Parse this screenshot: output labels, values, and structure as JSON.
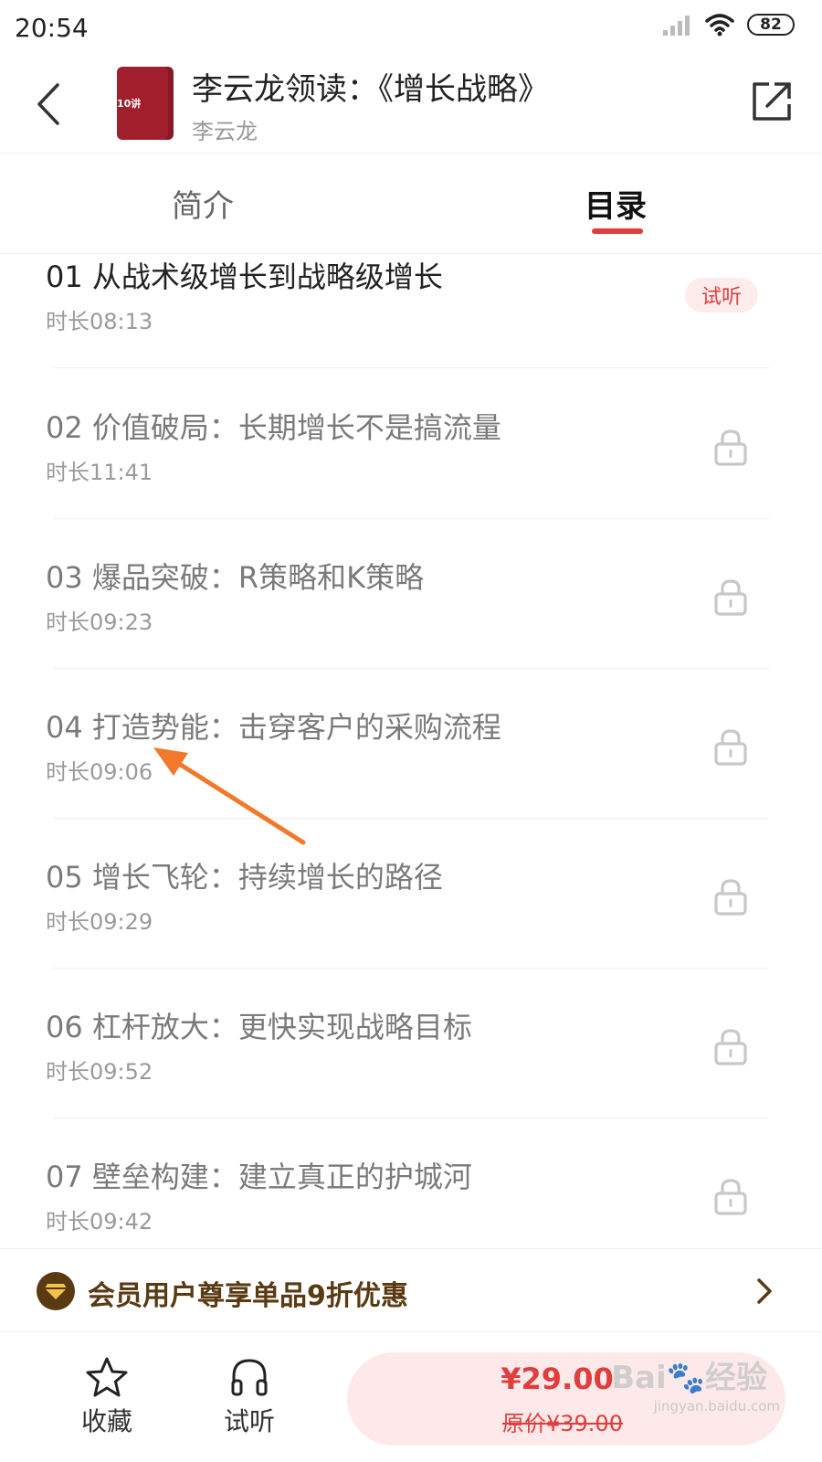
{
  "status_bar": {
    "time": "20:54",
    "battery": "82"
  },
  "header": {
    "title": "李云龙领读：《增长战略》",
    "author": "李云龙",
    "cover_text": "10讲"
  },
  "tabs": [
    {
      "label": "简介",
      "active": false
    },
    {
      "label": "目录",
      "active": true
    }
  ],
  "episodes": [
    {
      "title": "01 从战术级增长到战略级增长",
      "duration": "时长08:13",
      "badge": "试听",
      "locked": false
    },
    {
      "title": "02 价值破局：长期增长不是搞流量",
      "duration": "时长11:41",
      "locked": true
    },
    {
      "title": "03 爆品突破：R策略和K策略",
      "duration": "时长09:23",
      "locked": true
    },
    {
      "title": "04 打造势能：击穿客户的采购流程",
      "duration": "时长09:06",
      "locked": true
    },
    {
      "title": "05 增长飞轮：持续增长的路径",
      "duration": "时长09:29",
      "locked": true
    },
    {
      "title": "06 杠杆放大：更快实现战略目标",
      "duration": "时长09:52",
      "locked": true
    },
    {
      "title": "07 壁垒构建：建立真正的护城河",
      "duration": "时长09:42",
      "locked": true
    }
  ],
  "vip_banner": {
    "text": "会员用户尊享单品9折优惠"
  },
  "bottom_bar": {
    "favorite_label": "收藏",
    "listen_label": "试听",
    "price": "¥29.00",
    "original_price": "原价¥39.00"
  },
  "watermark": {
    "text": "Bai🐾经验",
    "sub": "jingyan.baidu.com"
  },
  "colors": {
    "accent": "#e23d3d",
    "vip": "#5a3a12",
    "badge_bg": "#fdecec"
  }
}
